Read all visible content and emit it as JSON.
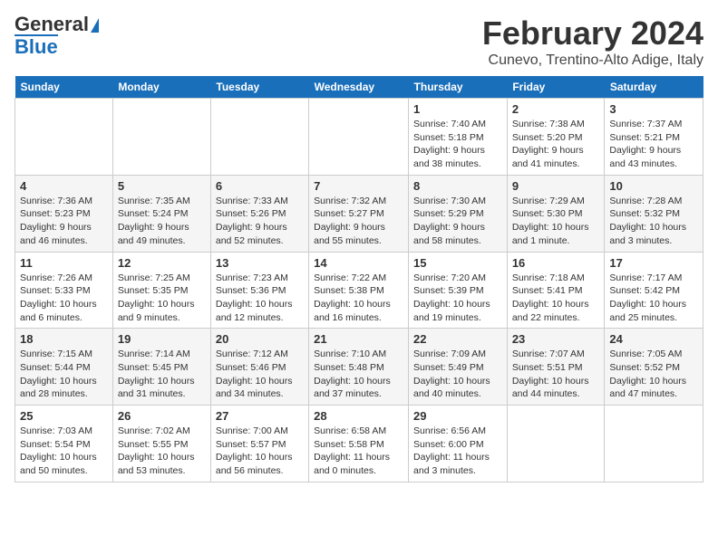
{
  "logo": {
    "part1": "General",
    "part2": "Blue"
  },
  "title": "February 2024",
  "subtitle": "Cunevo, Trentino-Alto Adige, Italy",
  "days_of_week": [
    "Sunday",
    "Monday",
    "Tuesday",
    "Wednesday",
    "Thursday",
    "Friday",
    "Saturday"
  ],
  "weeks": [
    [
      {
        "day": "",
        "info": ""
      },
      {
        "day": "",
        "info": ""
      },
      {
        "day": "",
        "info": ""
      },
      {
        "day": "",
        "info": ""
      },
      {
        "day": "1",
        "info": "Sunrise: 7:40 AM\nSunset: 5:18 PM\nDaylight: 9 hours\nand 38 minutes."
      },
      {
        "day": "2",
        "info": "Sunrise: 7:38 AM\nSunset: 5:20 PM\nDaylight: 9 hours\nand 41 minutes."
      },
      {
        "day": "3",
        "info": "Sunrise: 7:37 AM\nSunset: 5:21 PM\nDaylight: 9 hours\nand 43 minutes."
      }
    ],
    [
      {
        "day": "4",
        "info": "Sunrise: 7:36 AM\nSunset: 5:23 PM\nDaylight: 9 hours\nand 46 minutes."
      },
      {
        "day": "5",
        "info": "Sunrise: 7:35 AM\nSunset: 5:24 PM\nDaylight: 9 hours\nand 49 minutes."
      },
      {
        "day": "6",
        "info": "Sunrise: 7:33 AM\nSunset: 5:26 PM\nDaylight: 9 hours\nand 52 minutes."
      },
      {
        "day": "7",
        "info": "Sunrise: 7:32 AM\nSunset: 5:27 PM\nDaylight: 9 hours\nand 55 minutes."
      },
      {
        "day": "8",
        "info": "Sunrise: 7:30 AM\nSunset: 5:29 PM\nDaylight: 9 hours\nand 58 minutes."
      },
      {
        "day": "9",
        "info": "Sunrise: 7:29 AM\nSunset: 5:30 PM\nDaylight: 10 hours\nand 1 minute."
      },
      {
        "day": "10",
        "info": "Sunrise: 7:28 AM\nSunset: 5:32 PM\nDaylight: 10 hours\nand 3 minutes."
      }
    ],
    [
      {
        "day": "11",
        "info": "Sunrise: 7:26 AM\nSunset: 5:33 PM\nDaylight: 10 hours\nand 6 minutes."
      },
      {
        "day": "12",
        "info": "Sunrise: 7:25 AM\nSunset: 5:35 PM\nDaylight: 10 hours\nand 9 minutes."
      },
      {
        "day": "13",
        "info": "Sunrise: 7:23 AM\nSunset: 5:36 PM\nDaylight: 10 hours\nand 12 minutes."
      },
      {
        "day": "14",
        "info": "Sunrise: 7:22 AM\nSunset: 5:38 PM\nDaylight: 10 hours\nand 16 minutes."
      },
      {
        "day": "15",
        "info": "Sunrise: 7:20 AM\nSunset: 5:39 PM\nDaylight: 10 hours\nand 19 minutes."
      },
      {
        "day": "16",
        "info": "Sunrise: 7:18 AM\nSunset: 5:41 PM\nDaylight: 10 hours\nand 22 minutes."
      },
      {
        "day": "17",
        "info": "Sunrise: 7:17 AM\nSunset: 5:42 PM\nDaylight: 10 hours\nand 25 minutes."
      }
    ],
    [
      {
        "day": "18",
        "info": "Sunrise: 7:15 AM\nSunset: 5:44 PM\nDaylight: 10 hours\nand 28 minutes."
      },
      {
        "day": "19",
        "info": "Sunrise: 7:14 AM\nSunset: 5:45 PM\nDaylight: 10 hours\nand 31 minutes."
      },
      {
        "day": "20",
        "info": "Sunrise: 7:12 AM\nSunset: 5:46 PM\nDaylight: 10 hours\nand 34 minutes."
      },
      {
        "day": "21",
        "info": "Sunrise: 7:10 AM\nSunset: 5:48 PM\nDaylight: 10 hours\nand 37 minutes."
      },
      {
        "day": "22",
        "info": "Sunrise: 7:09 AM\nSunset: 5:49 PM\nDaylight: 10 hours\nand 40 minutes."
      },
      {
        "day": "23",
        "info": "Sunrise: 7:07 AM\nSunset: 5:51 PM\nDaylight: 10 hours\nand 44 minutes."
      },
      {
        "day": "24",
        "info": "Sunrise: 7:05 AM\nSunset: 5:52 PM\nDaylight: 10 hours\nand 47 minutes."
      }
    ],
    [
      {
        "day": "25",
        "info": "Sunrise: 7:03 AM\nSunset: 5:54 PM\nDaylight: 10 hours\nand 50 minutes."
      },
      {
        "day": "26",
        "info": "Sunrise: 7:02 AM\nSunset: 5:55 PM\nDaylight: 10 hours\nand 53 minutes."
      },
      {
        "day": "27",
        "info": "Sunrise: 7:00 AM\nSunset: 5:57 PM\nDaylight: 10 hours\nand 56 minutes."
      },
      {
        "day": "28",
        "info": "Sunrise: 6:58 AM\nSunset: 5:58 PM\nDaylight: 11 hours\nand 0 minutes."
      },
      {
        "day": "29",
        "info": "Sunrise: 6:56 AM\nSunset: 6:00 PM\nDaylight: 11 hours\nand 3 minutes."
      },
      {
        "day": "",
        "info": ""
      },
      {
        "day": "",
        "info": ""
      }
    ]
  ]
}
